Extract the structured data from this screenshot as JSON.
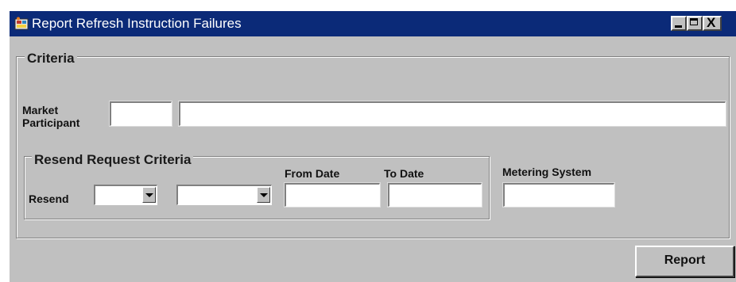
{
  "window": {
    "title": "Report Refresh Instruction Failures",
    "icon": "app-window-icon",
    "controls": {
      "minimize": "minimize-icon",
      "maximize": "maximize-icon",
      "close": "X"
    }
  },
  "criteria": {
    "group_label": "Criteria",
    "market_participant": {
      "label_line1": "Market",
      "label_line2": "Participant",
      "code_value": "",
      "name_value": ""
    },
    "resend_request": {
      "group_label": "Resend Request Criteria",
      "resend_label": "Resend",
      "resend_combo1_value": "",
      "resend_combo2_value": "",
      "from_date_label": "From Date",
      "from_date_value": "",
      "to_date_label": "To Date",
      "to_date_value": ""
    },
    "metering_system": {
      "label": "Metering System",
      "value": ""
    }
  },
  "actions": {
    "report_label": "Report"
  },
  "colors": {
    "titlebar": "#0b2a78",
    "window_bg": "#c0c0c0"
  }
}
